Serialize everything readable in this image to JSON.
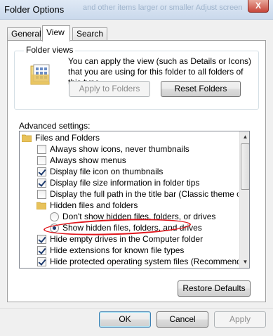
{
  "window": {
    "title": "Folder Options",
    "background_text": "and other items larger or smaller    Adjust screen",
    "close_label": "X"
  },
  "tabs": [
    {
      "label": "General",
      "active": false
    },
    {
      "label": "View",
      "active": true
    },
    {
      "label": "Search",
      "active": false
    }
  ],
  "folder_views": {
    "group_label": "Folder views",
    "description": "You can apply the view (such as Details or Icons) that you are using for this folder to all folders of this type.",
    "apply_button": "Apply to Folders",
    "reset_button": "Reset Folders",
    "icon": "folder-grid-icon"
  },
  "advanced": {
    "label": "Advanced settings:",
    "items": [
      {
        "kind": "folder",
        "label": "Files and Folders",
        "indent": 0
      },
      {
        "kind": "checkbox",
        "label": "Always show icons, never thumbnails",
        "checked": false,
        "indent": 1
      },
      {
        "kind": "checkbox",
        "label": "Always show menus",
        "checked": false,
        "indent": 1
      },
      {
        "kind": "checkbox",
        "label": "Display file icon on thumbnails",
        "checked": true,
        "indent": 1
      },
      {
        "kind": "checkbox",
        "label": "Display file size information in folder tips",
        "checked": true,
        "indent": 1
      },
      {
        "kind": "checkbox",
        "label": "Display the full path in the title bar (Classic theme only)",
        "checked": false,
        "indent": 1
      },
      {
        "kind": "folder",
        "label": "Hidden files and folders",
        "indent": 1
      },
      {
        "kind": "radio",
        "label": "Don't show hidden files, folders, or drives",
        "checked": false,
        "indent": 2
      },
      {
        "kind": "radio",
        "label": "Show hidden files, folders, and drives",
        "checked": true,
        "indent": 2
      },
      {
        "kind": "checkbox",
        "label": "Hide empty drives in the Computer folder",
        "checked": true,
        "indent": 1
      },
      {
        "kind": "checkbox",
        "label": "Hide extensions for known file types",
        "checked": true,
        "indent": 1
      },
      {
        "kind": "checkbox",
        "label": "Hide protected operating system files (Recommended)",
        "checked": true,
        "indent": 1
      }
    ],
    "restore_button": "Restore Defaults"
  },
  "footer": {
    "ok": "OK",
    "cancel": "Cancel",
    "apply": "Apply"
  },
  "colors": {
    "annotation": "#e0161c",
    "folder": "#e8c25a"
  }
}
